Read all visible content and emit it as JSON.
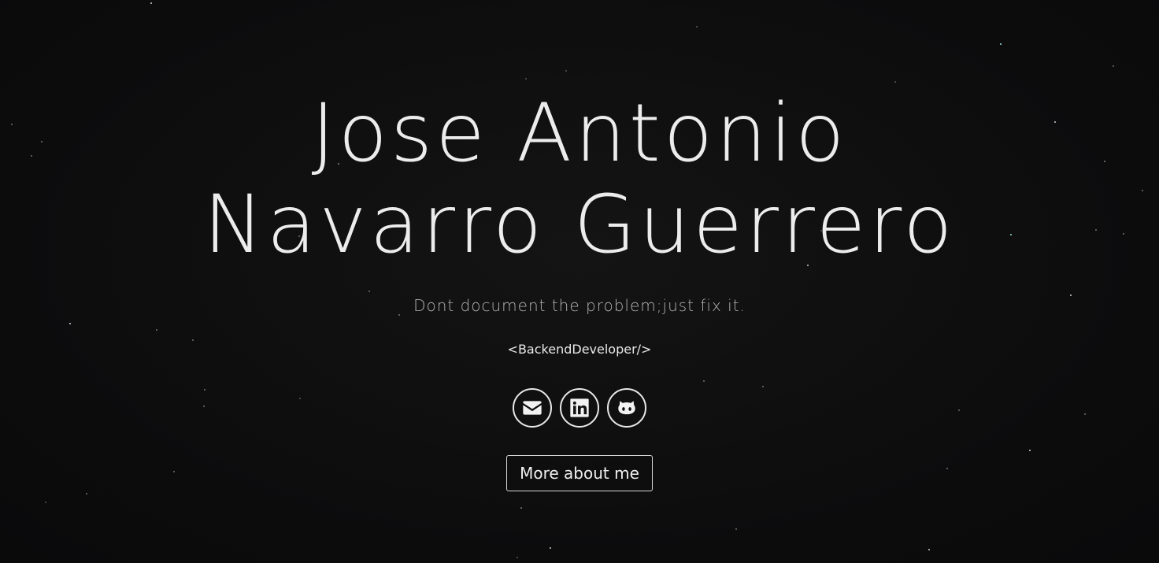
{
  "hero": {
    "name": "Jose Antonio Navarro Guerrero",
    "motto": "Dont document the problem;just fix it.",
    "role": "<BackendDeveloper/>"
  },
  "socials": [
    {
      "icon": "envelope-icon"
    },
    {
      "icon": "linkedin-icon"
    },
    {
      "icon": "github-icon"
    }
  ],
  "cta": {
    "label": "More about me"
  },
  "colors": {
    "background": "#0d0d0e",
    "text": "#ececec",
    "muted": "#b3b3b3"
  }
}
